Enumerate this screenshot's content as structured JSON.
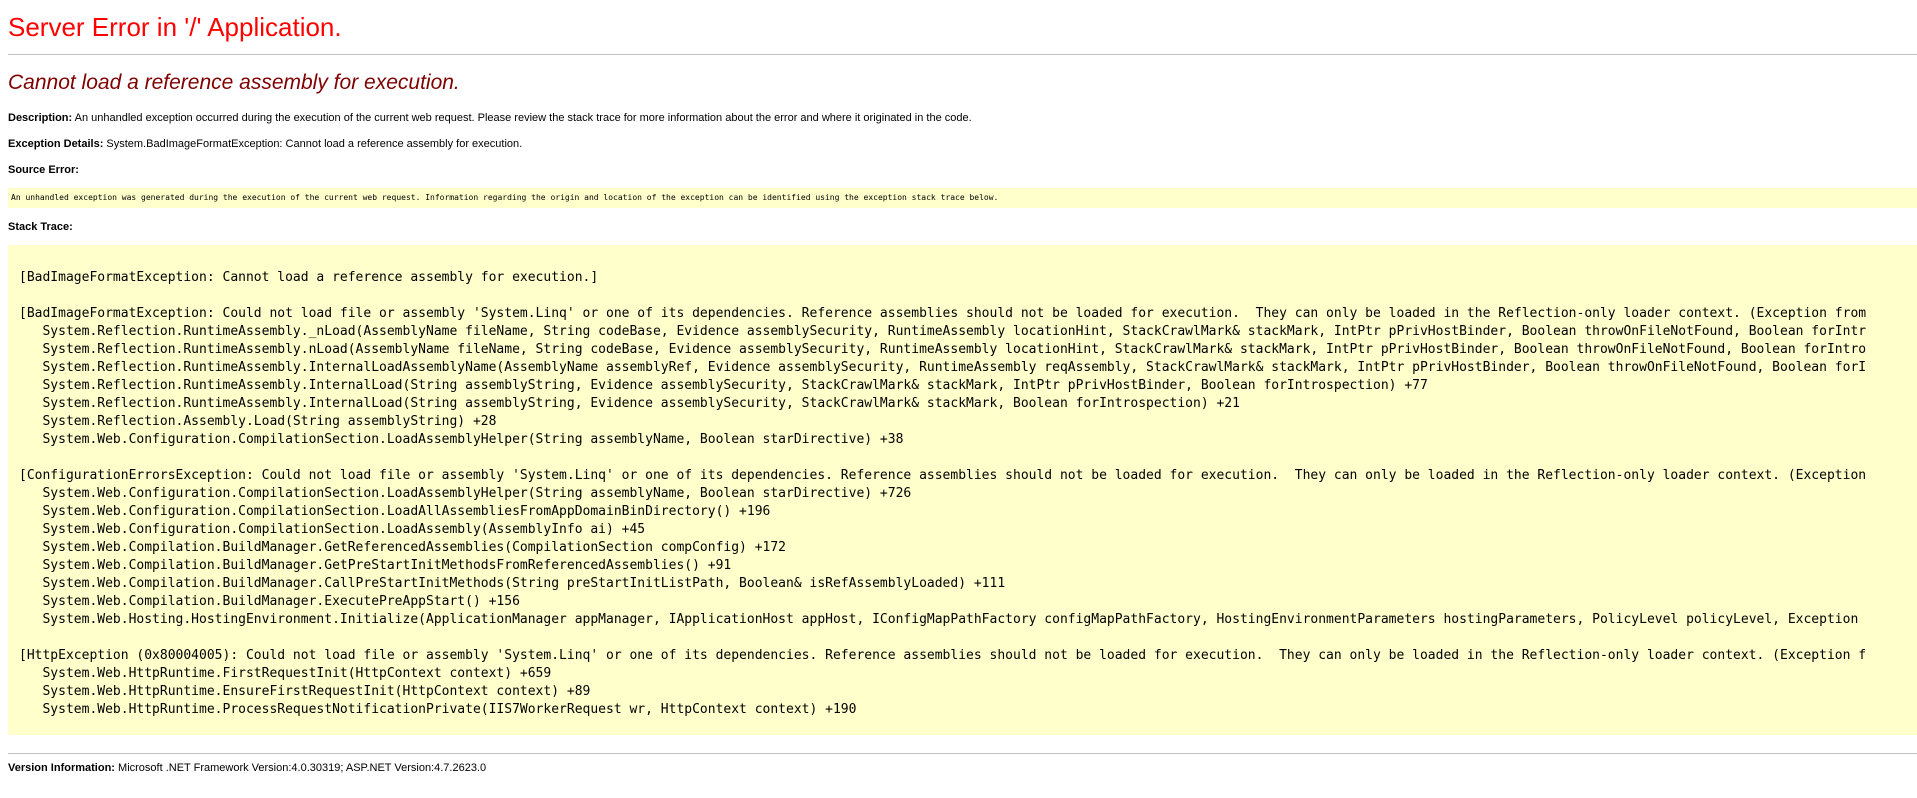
{
  "header": {
    "title": "Server Error in '/' Application.",
    "error_heading": "Cannot load a reference assembly for execution."
  },
  "description": {
    "label": "Description:",
    "text": " An unhandled exception occurred during the execution of the current web request. Please review the stack trace for more information about the error and where it originated in the code."
  },
  "exception_details": {
    "label": "Exception Details:",
    "text": " System.BadImageFormatException: Cannot load a reference assembly for execution."
  },
  "source_error": {
    "label": "Source Error:",
    "text": "An unhandled exception was generated during the execution of the current web request. Information regarding the origin and location of the exception can be identified using the exception stack trace below."
  },
  "stack_trace": {
    "label": "Stack Trace:",
    "lines": [
      "[BadImageFormatException: Cannot load a reference assembly for execution.]",
      "",
      "[BadImageFormatException: Could not load file or assembly 'System.Linq' or one of its dependencies. Reference assemblies should not be loaded for execution.  They can only be loaded in the Reflection-only loader context. (Exception from",
      "   System.Reflection.RuntimeAssembly._nLoad(AssemblyName fileName, String codeBase, Evidence assemblySecurity, RuntimeAssembly locationHint, StackCrawlMark& stackMark, IntPtr pPrivHostBinder, Boolean throwOnFileNotFound, Boolean forIntr",
      "   System.Reflection.RuntimeAssembly.nLoad(AssemblyName fileName, String codeBase, Evidence assemblySecurity, RuntimeAssembly locationHint, StackCrawlMark& stackMark, IntPtr pPrivHostBinder, Boolean throwOnFileNotFound, Boolean forIntro",
      "   System.Reflection.RuntimeAssembly.InternalLoadAssemblyName(AssemblyName assemblyRef, Evidence assemblySecurity, RuntimeAssembly reqAssembly, StackCrawlMark& stackMark, IntPtr pPrivHostBinder, Boolean throwOnFileNotFound, Boolean forI",
      "   System.Reflection.RuntimeAssembly.InternalLoad(String assemblyString, Evidence assemblySecurity, StackCrawlMark& stackMark, IntPtr pPrivHostBinder, Boolean forIntrospection) +77",
      "   System.Reflection.RuntimeAssembly.InternalLoad(String assemblyString, Evidence assemblySecurity, StackCrawlMark& stackMark, Boolean forIntrospection) +21",
      "   System.Reflection.Assembly.Load(String assemblyString) +28",
      "   System.Web.Configuration.CompilationSection.LoadAssemblyHelper(String assemblyName, Boolean starDirective) +38",
      "",
      "[ConfigurationErrorsException: Could not load file or assembly 'System.Linq' or one of its dependencies. Reference assemblies should not be loaded for execution.  They can only be loaded in the Reflection-only loader context. (Exception",
      "   System.Web.Configuration.CompilationSection.LoadAssemblyHelper(String assemblyName, Boolean starDirective) +726",
      "   System.Web.Configuration.CompilationSection.LoadAllAssembliesFromAppDomainBinDirectory() +196",
      "   System.Web.Configuration.CompilationSection.LoadAssembly(AssemblyInfo ai) +45",
      "   System.Web.Compilation.BuildManager.GetReferencedAssemblies(CompilationSection compConfig) +172",
      "   System.Web.Compilation.BuildManager.GetPreStartInitMethodsFromReferencedAssemblies() +91",
      "   System.Web.Compilation.BuildManager.CallPreStartInitMethods(String preStartInitListPath, Boolean& isRefAssemblyLoaded) +111",
      "   System.Web.Compilation.BuildManager.ExecutePreAppStart() +156",
      "   System.Web.Hosting.HostingEnvironment.Initialize(ApplicationManager appManager, IApplicationHost appHost, IConfigMapPathFactory configMapPathFactory, HostingEnvironmentParameters hostingParameters, PolicyLevel policyLevel, Exception",
      "",
      "[HttpException (0x80004005): Could not load file or assembly 'System.Linq' or one of its dependencies. Reference assemblies should not be loaded for execution.  They can only be loaded in the Reflection-only loader context. (Exception f",
      "   System.Web.HttpRuntime.FirstRequestInit(HttpContext context) +659",
      "   System.Web.HttpRuntime.EnsureFirstRequestInit(HttpContext context) +89",
      "   System.Web.HttpRuntime.ProcessRequestNotificationPrivate(IIS7WorkerRequest wr, HttpContext context) +190"
    ]
  },
  "version_info": {
    "label": "Version Information:",
    "text": " Microsoft .NET Framework Version:4.0.30319; ASP.NET Version:4.7.2623.0"
  },
  "colors": {
    "title": "#ff0000",
    "heading": "#800000",
    "code_background": "#ffffcc",
    "rule": "#c0c0c0"
  }
}
